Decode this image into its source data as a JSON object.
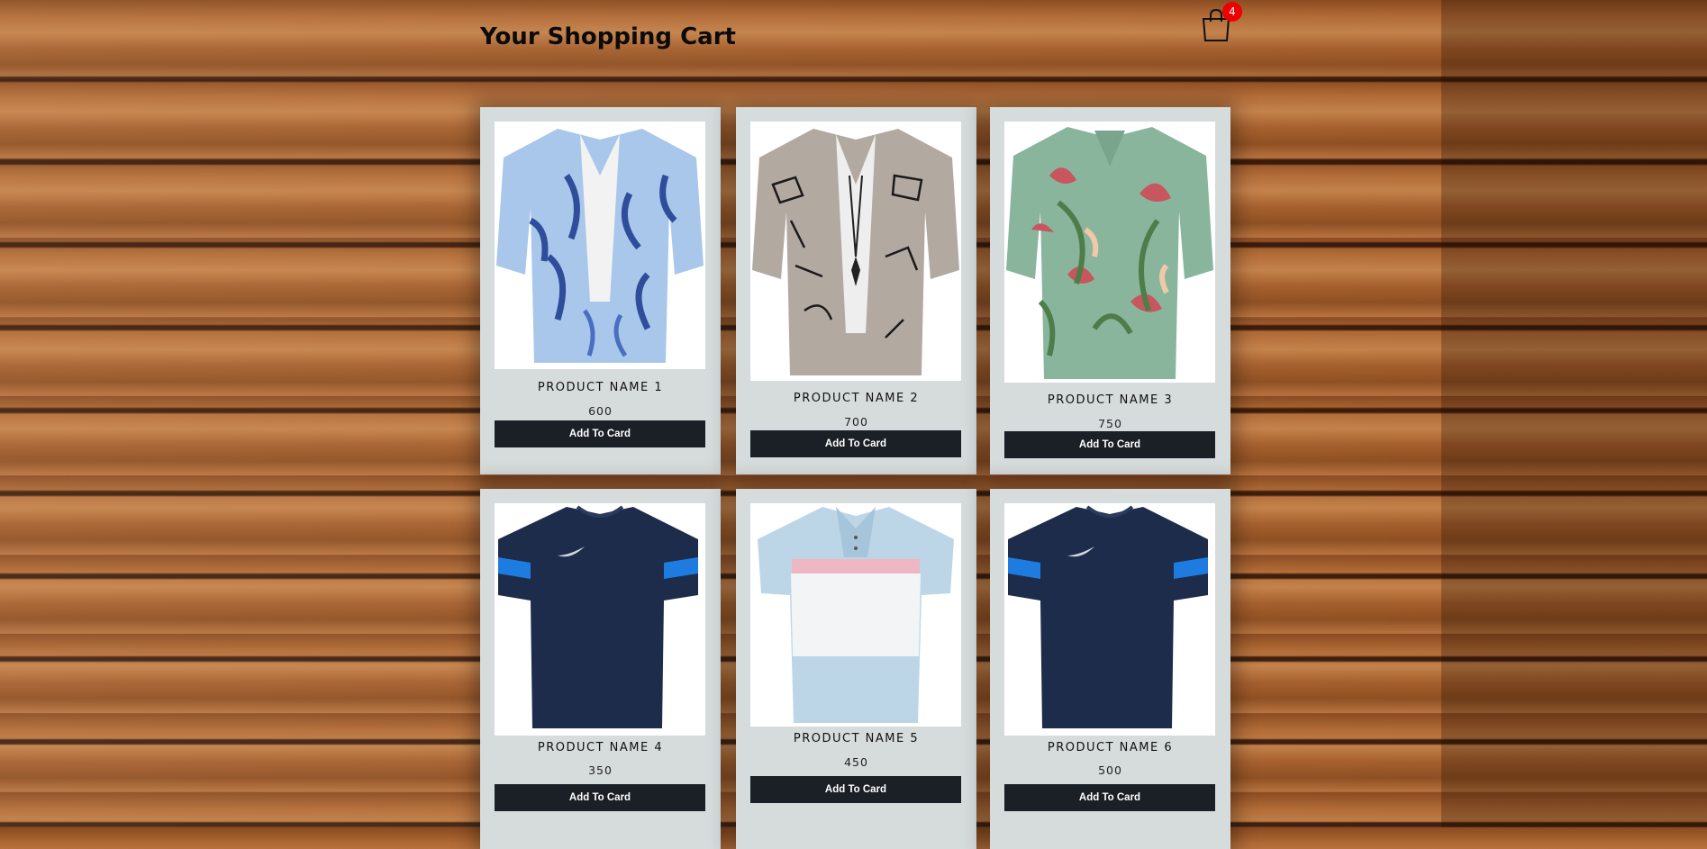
{
  "header": {
    "title": "Your Shopping Cart"
  },
  "cart": {
    "count": "4",
    "icon": "shopping-bag-icon"
  },
  "products": [
    {
      "name": "PRODUCT NAME 1",
      "price": "600",
      "button": "Add To Card",
      "image": "blue-floral-shirt"
    },
    {
      "name": "PRODUCT NAME 2",
      "price": "700",
      "button": "Add To Card",
      "image": "grey-sketch-shirt"
    },
    {
      "name": "PRODUCT NAME 3",
      "price": "750",
      "button": "Add To Card",
      "image": "green-tropical-shirt"
    },
    {
      "name": "PRODUCT NAME 4",
      "price": "350",
      "button": "Add To Card",
      "image": "navy-sport-tee"
    },
    {
      "name": "PRODUCT NAME 5",
      "price": "450",
      "button": "Add To Card",
      "image": "striped-polo-shirt"
    },
    {
      "name": "PRODUCT NAME 6",
      "price": "500",
      "button": "Add To Card",
      "image": "navy-sport-tee"
    }
  ],
  "colors": {
    "badge": "#ee0000",
    "button": "#1b1f26",
    "card": "#d6dbdc"
  }
}
